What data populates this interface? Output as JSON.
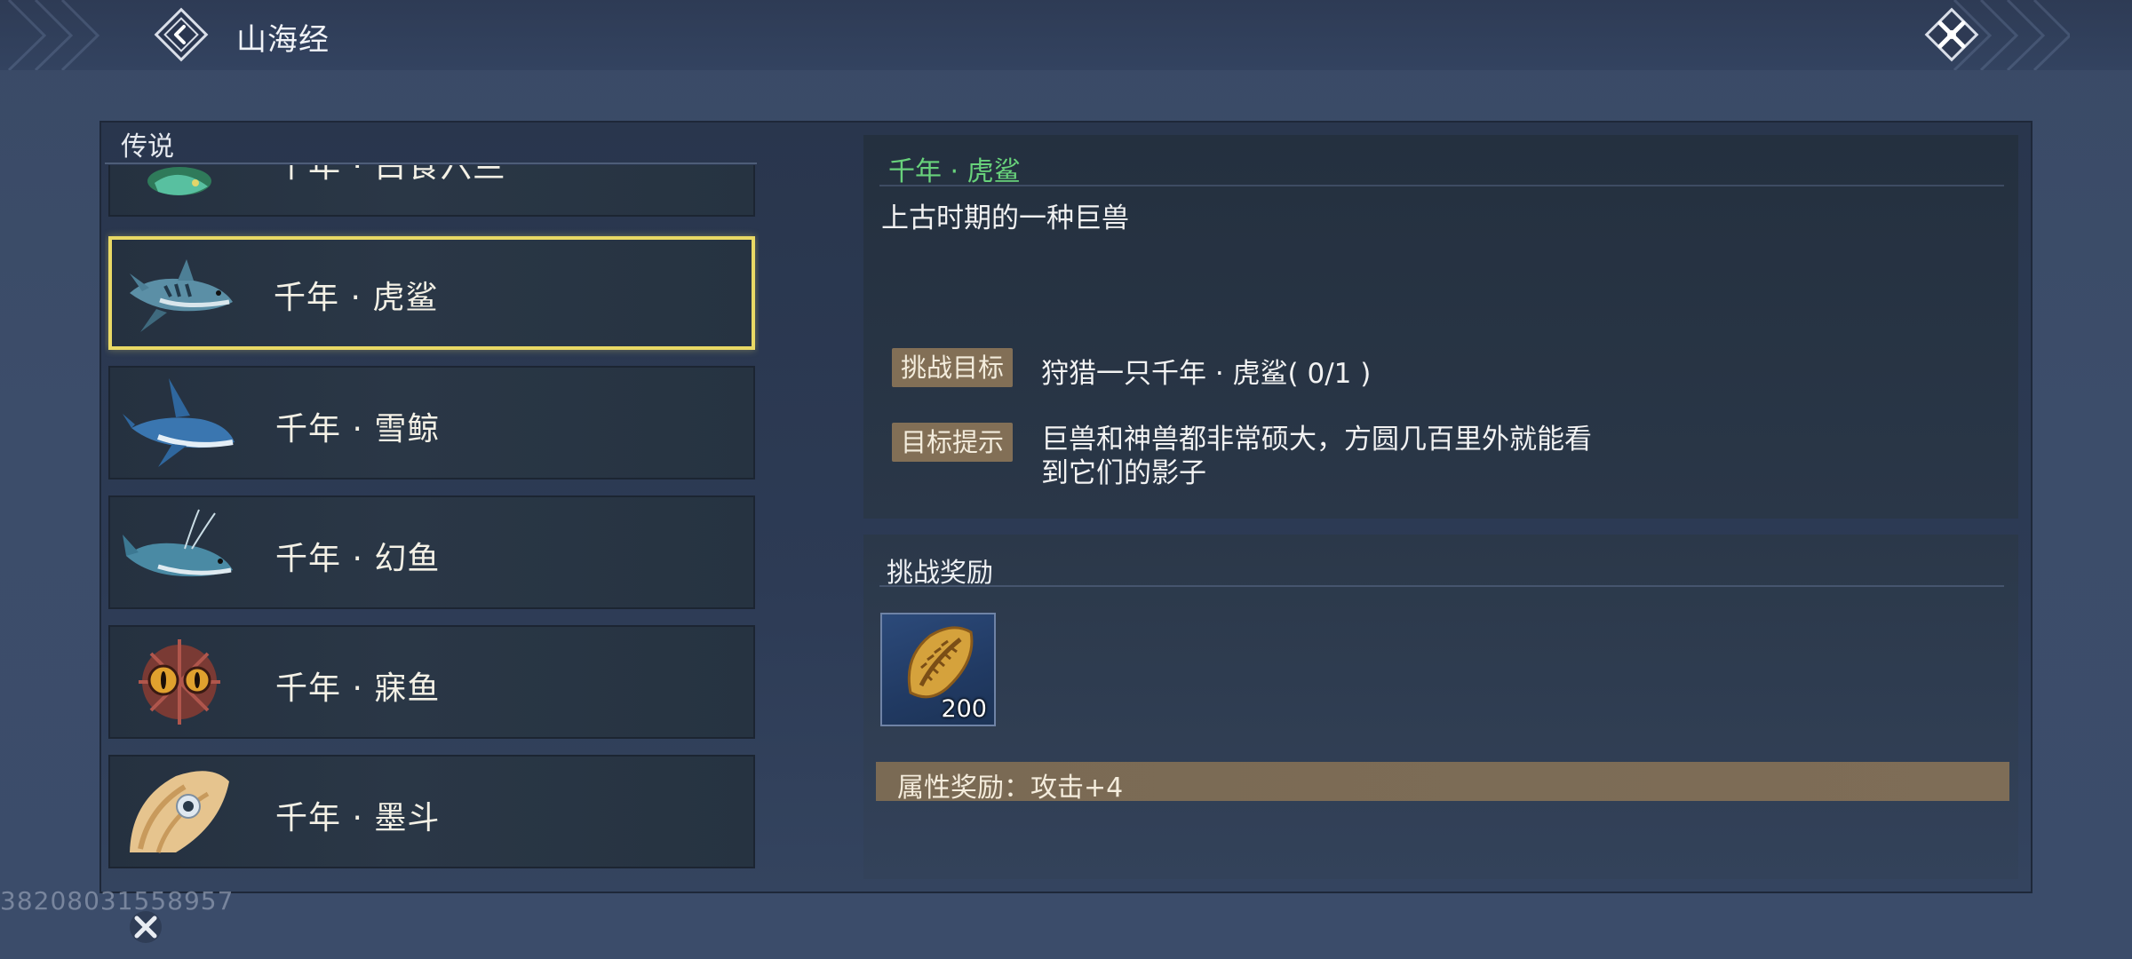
{
  "header": {
    "title": "山海经",
    "back_icon": "back-arrow-icon",
    "close_icon": "close-icon"
  },
  "list": {
    "category": "传说",
    "items": [
      {
        "label": "千年 · 白食六兰",
        "icon": "green-dragon-icon",
        "partial": true
      },
      {
        "label": "千年 · 虎鲨",
        "icon": "tiger-shark-icon",
        "selected": true
      },
      {
        "label": "千年 · 雪鲸",
        "icon": "snow-whale-icon"
      },
      {
        "label": "千年 · 幻鱼",
        "icon": "phantom-fish-icon"
      },
      {
        "label": "千年 · 寐鱼",
        "icon": "eyed-fish-icon"
      },
      {
        "label": "千年 · 墨斗",
        "icon": "cuttlefish-icon"
      }
    ]
  },
  "detail": {
    "title": "千年 · 虎鲨",
    "description": "上古时期的一种巨兽",
    "goal_tag": "挑战目标",
    "goal_text": "狩猎一只千年 · 虎鲨( 0/1 )",
    "hint_tag": "目标提示",
    "hint_text": "巨兽和神兽都非常硕大，方圆几百里外就能看到它们的影子"
  },
  "reward": {
    "title": "挑战奖励",
    "item_icon": "shell-coin-icon",
    "item_count": "200",
    "attribute": "属性奖励：攻击+4"
  },
  "watermark": "38208031558957",
  "colors": {
    "accent_green": "#68d27b",
    "selection_border": "#e9d965",
    "tag_bg": "#826f56"
  }
}
